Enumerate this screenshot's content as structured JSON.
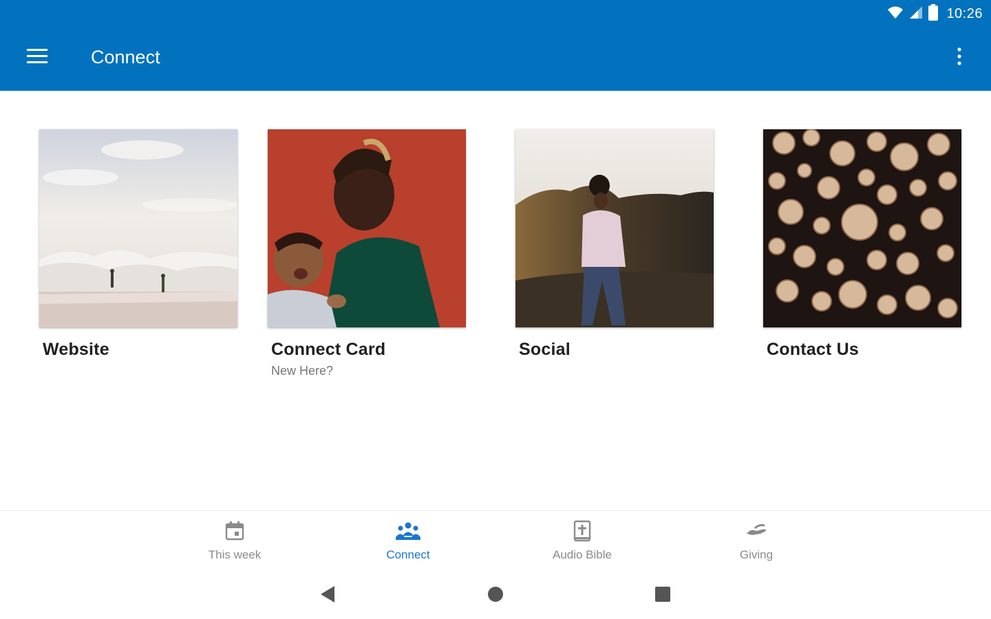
{
  "status_bar": {
    "time": "10:26",
    "icons": [
      "wifi-icon",
      "signal-icon",
      "battery-icon"
    ]
  },
  "app_bar": {
    "title": "Connect",
    "menu_icon": "hamburger-menu-icon",
    "overflow_icon": "more-vert-icon",
    "color": "#0272bf"
  },
  "cards": [
    {
      "title": "Website",
      "subtitle": "",
      "image": "beach-waves-photo"
    },
    {
      "title": "Connect Card",
      "subtitle": "New Here?",
      "image": "father-and-baby-photo"
    },
    {
      "title": "Social",
      "subtitle": "",
      "image": "woman-on-hill-photo"
    },
    {
      "title": "Contact Us",
      "subtitle": "",
      "image": "log-stack-photo"
    }
  ],
  "bottom_nav": {
    "active_color": "#1976d2",
    "inactive_color": "#8a8a8a",
    "items": [
      {
        "label": "This week",
        "icon": "calendar-icon",
        "active": false
      },
      {
        "label": "Connect",
        "icon": "people-group-icon",
        "active": true
      },
      {
        "label": "Audio Bible",
        "icon": "bible-icon",
        "active": false
      },
      {
        "label": "Giving",
        "icon": "giving-hand-icon",
        "active": false
      }
    ]
  },
  "system_nav": {
    "icons": [
      "back-icon",
      "home-icon",
      "recents-icon"
    ]
  }
}
